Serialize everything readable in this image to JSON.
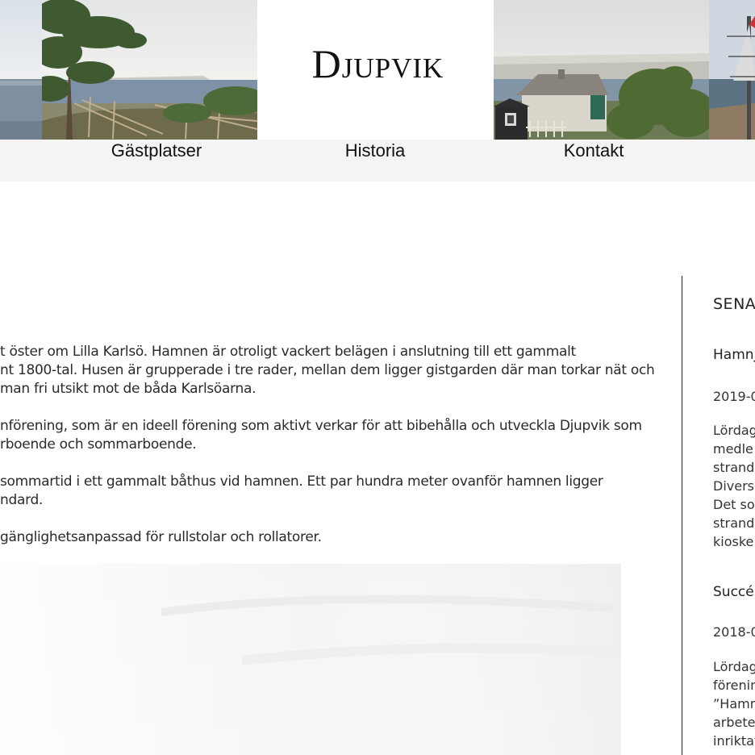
{
  "site": {
    "logo_text": "Djupvik"
  },
  "nav": {
    "items": [
      {
        "label": "Gästplatser"
      },
      {
        "label": "Historia"
      },
      {
        "label": "Kontakt"
      }
    ]
  },
  "main": {
    "paragraphs": [
      {
        "lines": [
          "t öster om Lilla Karlsö. Hamnen är otroligt vackert belägen i anslutning till ett gammalt",
          "nt 1800-tal. Husen är grupperade i tre rader, mellan dem ligger gistgarden där man torkar nät och",
          " man fri utsikt mot de båda Karlsöarna."
        ]
      },
      {
        "lines": [
          "nförening, som är en ideell förening som aktivt verkar för att bibehålla och utveckla Djupvik som",
          "rboende och sommarboende."
        ]
      },
      {
        "lines": [
          " sommartid i ett gammalt båthus vid hamnen. Ett par hundra meter ovanför hamnen ligger",
          "ndard."
        ]
      },
      {
        "lines": [
          "gänglighetsanpassad för rullstolar och rollatorer."
        ]
      }
    ]
  },
  "sidebar": {
    "heading": "SENA",
    "posts": [
      {
        "title": "Hamnj",
        "date": "2019-0",
        "excerpt_lines": [
          "Lördag",
          "medle",
          "strand",
          "Diverse",
          "Det so",
          "strand",
          "kioske"
        ]
      },
      {
        "title": "Succé",
        "date": "2018-0",
        "excerpt_lines": [
          "Lördag",
          "förenin",
          "”Hamn",
          "arbete",
          "inriktat"
        ]
      }
    ]
  },
  "colors": {
    "nav_background": "#f5f4f2",
    "text": "#2a2a2a",
    "divider": "#222222"
  }
}
